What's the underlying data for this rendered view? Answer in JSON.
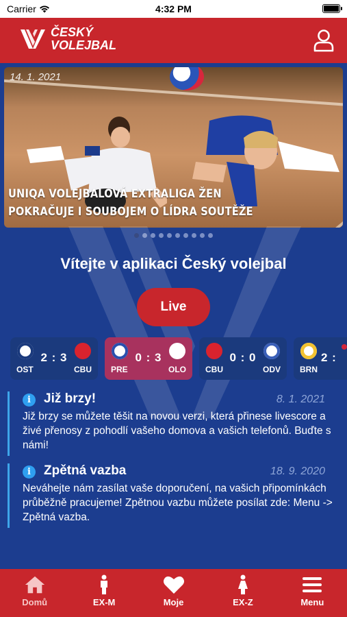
{
  "status_bar": {
    "carrier": "Carrier",
    "time": "4:32 PM"
  },
  "header": {
    "logo_line1": "ČESKÝ",
    "logo_line2": "VOLEJBAL"
  },
  "hero": {
    "date": "14. 1. 2021",
    "headline": "UNIQA VOLEJBALOVÁ EXTRALIGA ŽEN POKRAČUJE I SOUBOJEM O LÍDRA SOUTĚŽE",
    "slide_count": 10,
    "active_slide": 1
  },
  "welcome": "Vítejte v aplikaci Český volejbal",
  "live_button": "Live",
  "matches": [
    {
      "team_a": "OST",
      "score": "2 : 3",
      "team_b": "CBU",
      "highlight": false
    },
    {
      "team_a": "PRE",
      "score": "0 : 3",
      "team_b": "OLO",
      "highlight": true
    },
    {
      "team_a": "CBU",
      "score": "0 : 0",
      "team_b": "ODV",
      "highlight": false
    },
    {
      "team_a": "BRN",
      "score": "2 :",
      "team_b": "",
      "highlight": false
    }
  ],
  "news": [
    {
      "title": "Již brzy!",
      "date": "8. 1. 2021",
      "body": "Již brzy se můžete těšit na novou verzi, která přinese livescore a živé přenosy z pohodlí vašeho domova a vašich telefonů. Buďte s námi!"
    },
    {
      "title": "Zpětná vazba",
      "date": "18. 9. 2020",
      "body": "Neváhejte nám zasílat vaše doporučení, na vašich připomínkách průběžně pracujeme! Zpětnou vazbu můžete posílat zde: Menu -> Zpětná vazba."
    }
  ],
  "tabs": [
    {
      "label": "Domů",
      "icon": "home-icon"
    },
    {
      "label": "EX-M",
      "icon": "man-icon"
    },
    {
      "label": "Moje",
      "icon": "heart-icon"
    },
    {
      "label": "EX-Z",
      "icon": "woman-icon"
    },
    {
      "label": "Menu",
      "icon": "hamburger-icon"
    }
  ],
  "colors": {
    "brand_red": "#c8262c",
    "background_blue": "#1c3d8f",
    "info_blue": "#2f9ff0",
    "highlight_match": "#a8325e"
  }
}
